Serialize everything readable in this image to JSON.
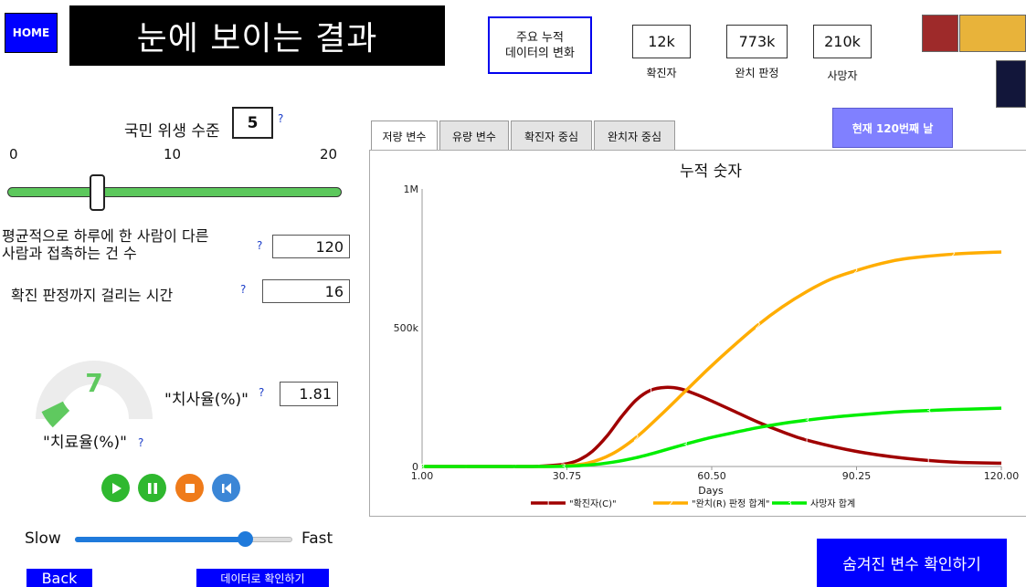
{
  "header": {
    "home_label": "HOME",
    "title": "눈에 보이는 결과",
    "summary_line1": "주요 누적",
    "summary_line2": "데이터의 변화",
    "stats": [
      {
        "value": "12k",
        "label": "확진자",
        "color": "#d98080"
      },
      {
        "value": "773k",
        "label": "완치 판정",
        "color": "#ffd98a"
      },
      {
        "value": "210k",
        "label": "사망자",
        "color": "#8cff8c"
      }
    ]
  },
  "controls": {
    "hygiene_label": "국민 위생 수준",
    "hygiene_value": "5",
    "hygiene_min": "0",
    "hygiene_mid": "10",
    "hygiene_max": "20",
    "hygiene_level": 5,
    "hygiene_range": [
      0,
      20
    ],
    "contacts_line1": "평균적으로 하루에 한 사람이 다른",
    "contacts_line2": "사람과 접촉하는 건 수",
    "contacts_value": "120",
    "time_label": "확진 판정까지 걸리는 시간",
    "time_value": "16",
    "cure_rate_value": "7",
    "cure_rate_label": "\"치료율(%)\"",
    "death_rate_label": "\"치사율(%)\"",
    "death_rate_value": "1.81",
    "qmark": "?",
    "speed_slow": "Slow",
    "speed_fast": "Fast",
    "speed_level": 0.78
  },
  "tabs": [
    {
      "label": "저량 변수",
      "active": true
    },
    {
      "label": "유량 변수",
      "active": false
    },
    {
      "label": "확진자 중심",
      "active": false
    },
    {
      "label": "완치자 중심",
      "active": false
    }
  ],
  "day_button": "현재 120번째 날",
  "footer": {
    "back_label": "Back",
    "data_label": "데이터로 확인하기",
    "hidden_label": "숨겨진 변수 확인하기"
  },
  "colors": {
    "confirmed": "#a00000",
    "recovered": "#ffad00",
    "deaths": "#00ee00"
  },
  "chart_data": {
    "type": "line",
    "title": "누적 숫자",
    "xlabel": "Days",
    "ylabel": "",
    "xlim": [
      1,
      120
    ],
    "ylim": [
      0,
      1000000
    ],
    "x_ticks": [
      "1.00",
      "30.75",
      "60.50",
      "90.25",
      "120.00"
    ],
    "x_tick_values": [
      1,
      30.75,
      60.5,
      90.25,
      120
    ],
    "y_ticks": [
      "0",
      "500k",
      "1M"
    ],
    "y_tick_values": [
      0,
      500000,
      1000000
    ],
    "legend_position": "bottom",
    "series": [
      {
        "name": "\"확진자(C)\"",
        "marker": "1",
        "color": "#a00000",
        "x": [
          1,
          10,
          20,
          25,
          30,
          33,
          36,
          39,
          42,
          45,
          48,
          51,
          54,
          57,
          60,
          65,
          70,
          75,
          80,
          90,
          100,
          110,
          120
        ],
        "y": [
          0,
          0,
          0,
          1000,
          8000,
          22000,
          55000,
          110000,
          180000,
          240000,
          275000,
          285000,
          280000,
          262000,
          240000,
          200000,
          160000,
          125000,
          95000,
          55000,
          30000,
          16000,
          12000
        ]
      },
      {
        "name": "\"완치(R) 판정 합계\"",
        "marker": "2",
        "color": "#ffad00",
        "x": [
          1,
          10,
          20,
          25,
          30,
          35,
          40,
          45,
          50,
          55,
          60,
          65,
          70,
          75,
          80,
          85,
          90,
          95,
          100,
          110,
          120
        ],
        "y": [
          0,
          0,
          0,
          0,
          2000,
          12000,
          45000,
          105000,
          185000,
          270000,
          355000,
          435000,
          510000,
          575000,
          630000,
          675000,
          705000,
          730000,
          748000,
          765000,
          773000
        ]
      },
      {
        "name": "사망자 합계",
        "marker": "3",
        "color": "#00ee00",
        "x": [
          1,
          10,
          20,
          25,
          30,
          35,
          40,
          45,
          50,
          55,
          60,
          65,
          70,
          75,
          80,
          85,
          90,
          95,
          100,
          110,
          120
        ],
        "y": [
          0,
          0,
          0,
          0,
          1000,
          5000,
          15000,
          32000,
          55000,
          80000,
          103000,
          122000,
          140000,
          155000,
          167000,
          177000,
          185000,
          192000,
          198000,
          205000,
          210000
        ]
      }
    ]
  }
}
